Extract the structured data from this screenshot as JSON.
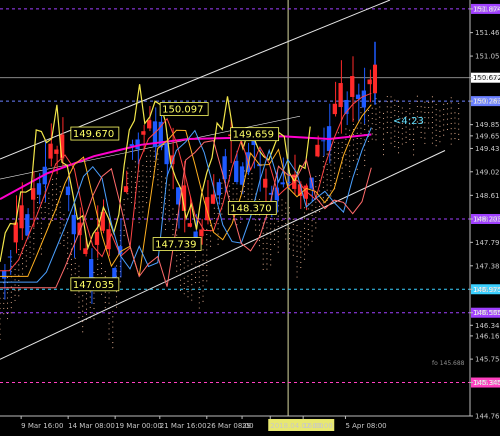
{
  "chart_data": {
    "type": "candlestick",
    "y_range": [
      144.76,
      152.03
    ],
    "y_ticks": [
      "151.874",
      "151.460",
      "151.050",
      "150.672",
      "150.263",
      "149.852",
      "149.656",
      "149.436",
      "149.028",
      "148.616",
      "148.203",
      "147.795",
      "147.385",
      "146.975",
      "146.565",
      "146.345",
      "146.16",
      "145.754",
      "145.345",
      "144.760"
    ],
    "y_tick_values": [
      151.874,
      151.46,
      151.05,
      150.672,
      150.263,
      149.852,
      149.656,
      149.436,
      149.028,
      148.616,
      148.203,
      147.795,
      147.385,
      146.975,
      146.565,
      146.345,
      146.16,
      145.754,
      145.345,
      144.76
    ],
    "x_labels": [
      "9 Mar 16:00",
      "14 Mar 08:00",
      "19 Mar 00:00",
      "21 Mar 16:00",
      "26 Mar 08:00",
      "29",
      "2018.04.02 00:00",
      "16:00",
      "5 Apr 08:00"
    ],
    "x_label_frac": [
      0.045,
      0.145,
      0.245,
      0.34,
      0.44,
      0.515,
      0.575,
      0.645,
      0.735
    ],
    "current_price": 150.672,
    "current_price_label": "150.672",
    "countdown": "<4:23",
    "annotations": [
      {
        "text": "150.097",
        "x_frac": 0.345,
        "y": 150.097
      },
      {
        "text": "149.670",
        "x_frac": 0.155,
        "y": 149.67
      },
      {
        "text": "149.659",
        "x_frac": 0.495,
        "y": 149.659
      },
      {
        "text": "148.370",
        "x_frac": 0.49,
        "y": 148.37
      },
      {
        "text": "147.739",
        "x_frac": 0.33,
        "y": 147.739
      },
      {
        "text": "147.035",
        "x_frac": 0.155,
        "y": 147.035
      }
    ],
    "price_levels": [
      {
        "value": 151.874,
        "label": "151.874",
        "color": "#a040ff"
      },
      {
        "value": 150.263,
        "label": "150.263",
        "color": "#6a7fff"
      },
      {
        "value": 148.203,
        "label": "148.203",
        "color": "#a040ff"
      },
      {
        "value": 146.975,
        "label": "146.975",
        "color": "#3ad0ff"
      },
      {
        "value": 146.565,
        "label": "146.565",
        "color": "#a040ff"
      },
      {
        "value": 145.345,
        "label": "145.345",
        "color": "#ff40c0"
      }
    ],
    "note": "fo 145.688",
    "colors": {
      "background": "#000000",
      "bull": "#1e5aff",
      "bear": "#ff2a2a",
      "magenta_ma": "#ff00cc",
      "yellow_line": "#f2e64a",
      "cloud": "#f0b898",
      "channel": "#e6e6e6"
    }
  }
}
